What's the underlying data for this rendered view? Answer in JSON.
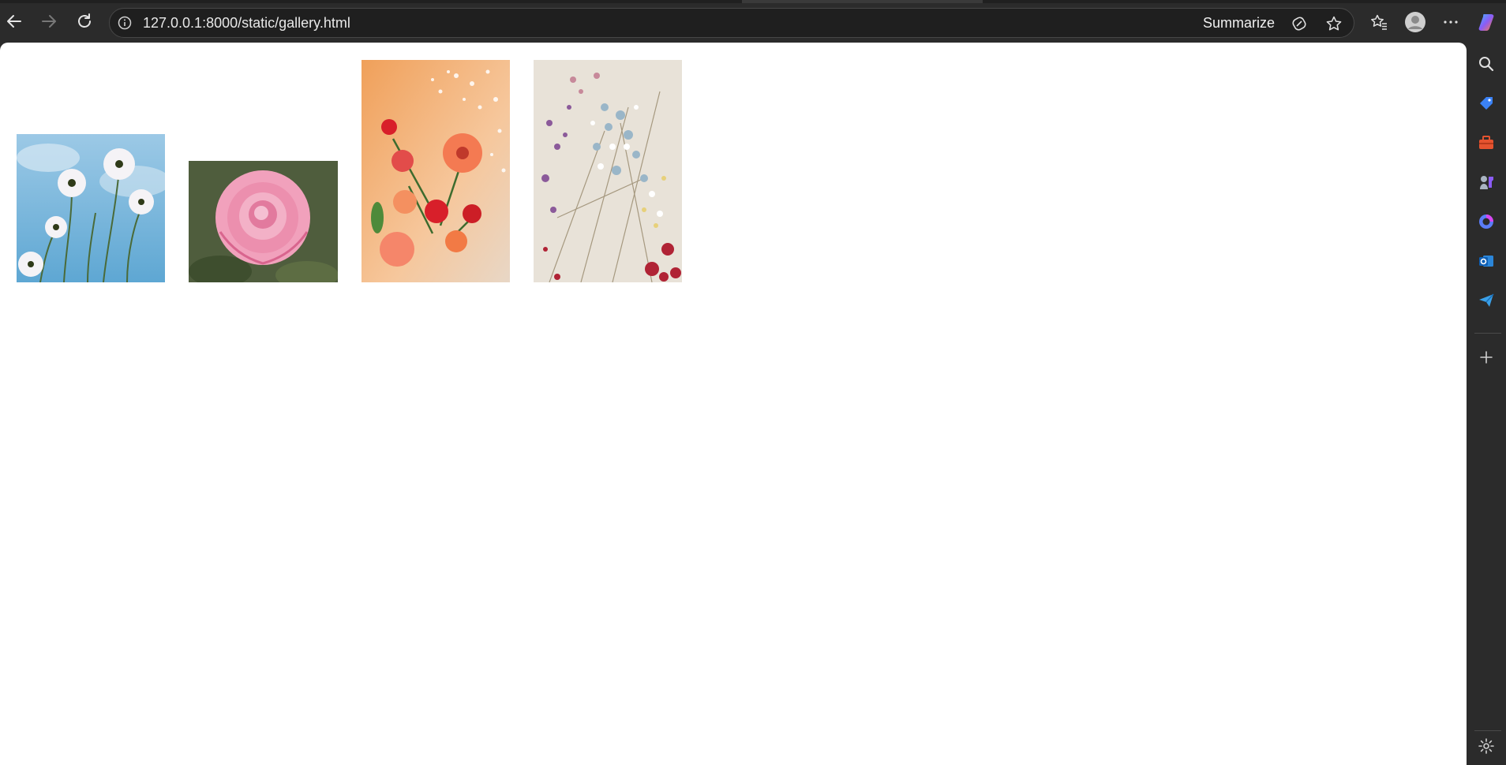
{
  "address_bar": {
    "url": "127.0.0.1:8000/static/gallery.html",
    "summarize_label": "Summarize"
  },
  "toolbar": {
    "back": "back-icon",
    "forward": "forward-icon",
    "refresh": "refresh-icon",
    "site_info": "info-icon",
    "favorites": "favorites-icon",
    "profile": "profile-icon",
    "more": "more-icon",
    "copilot": "copilot-icon"
  },
  "gallery": {
    "images": [
      {
        "subject": "white cosmos flowers against blue sky",
        "colors": [
          "#7db6d9",
          "#e8eef5",
          "#4c6b3a"
        ]
      },
      {
        "subject": "pink rose",
        "colors": [
          "#4e5c3c",
          "#f2a2bd",
          "#d9658e"
        ]
      },
      {
        "subject": "red and orange bouquet with baby's breath",
        "colors": [
          "#f2b27a",
          "#e0352f",
          "#f07f5a"
        ]
      },
      {
        "subject": "colorful baby's breath",
        "colors": [
          "#e9e2d8",
          "#9fb8c9",
          "#b02335"
        ]
      }
    ]
  },
  "sidebar": {
    "items": [
      "search-icon",
      "shopping-tag-icon",
      "tools-icon",
      "games-icon",
      "copilot-icon",
      "outlook-icon",
      "send-icon",
      "add-icon",
      "settings-icon"
    ]
  }
}
